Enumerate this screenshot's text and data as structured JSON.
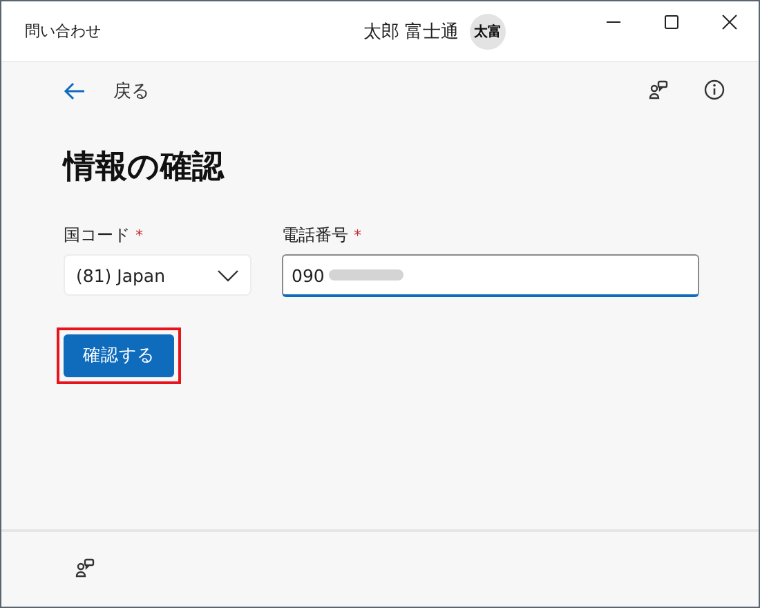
{
  "window": {
    "title": "問い合わせ",
    "user_name": "太郎 富士通",
    "avatar_initials": "太富"
  },
  "nav": {
    "back_label": "戻る"
  },
  "heading": "情報の確認",
  "fields": [
    {
      "kind": "select",
      "label": "国コード",
      "required_mark": "*",
      "value": "(81) Japan"
    },
    {
      "kind": "text",
      "label": "電話番号",
      "required_mark": "*",
      "value": "090",
      "redacted": true,
      "focused": true
    }
  ],
  "confirm_button": {
    "label": "確認する",
    "highlighted": true
  }
}
